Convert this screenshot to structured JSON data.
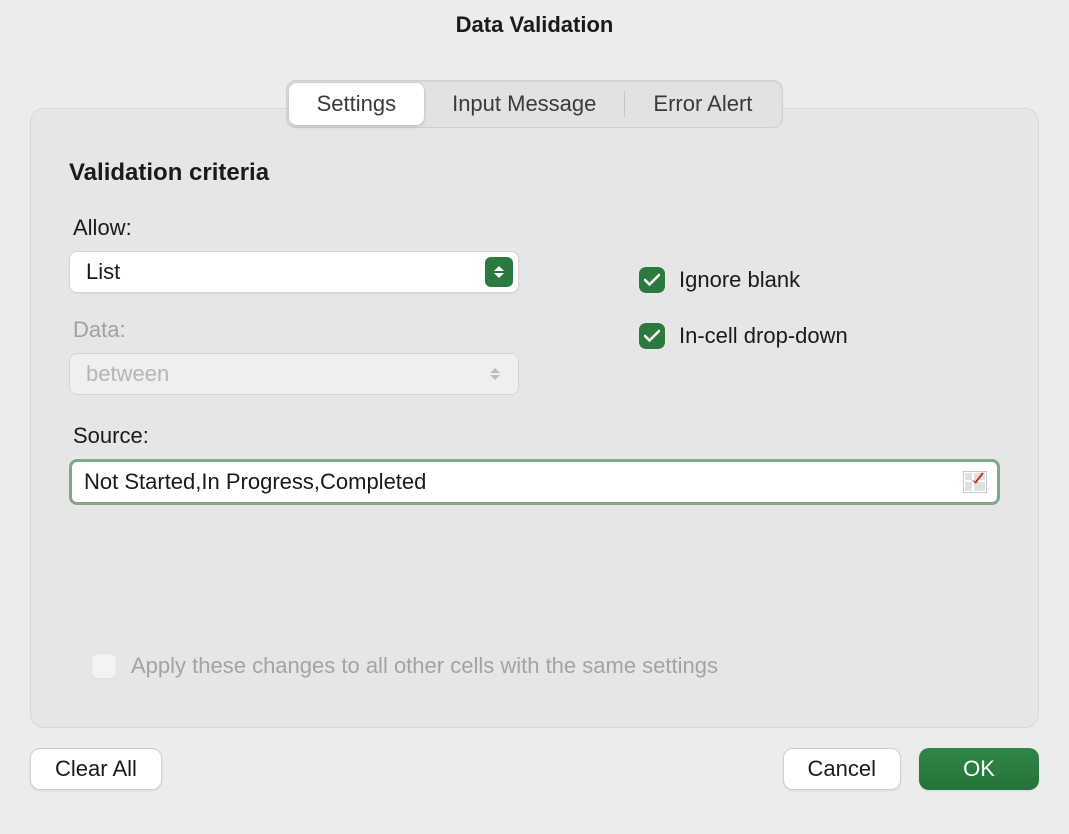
{
  "dialog": {
    "title": "Data Validation"
  },
  "tabs": {
    "settings": "Settings",
    "input_message": "Input Message",
    "error_alert": "Error Alert"
  },
  "section": {
    "title": "Validation criteria"
  },
  "labels": {
    "allow": "Allow:",
    "data": "Data:",
    "source": "Source:"
  },
  "fields": {
    "allow_value": "List",
    "data_value": "between",
    "source_value": "Not Started,In Progress,Completed"
  },
  "checkboxes": {
    "ignore_blank": "Ignore blank",
    "in_cell_dropdown": "In-cell drop-down",
    "apply_all": "Apply these changes to all other cells with the same settings"
  },
  "buttons": {
    "clear_all": "Clear All",
    "cancel": "Cancel",
    "ok": "OK"
  }
}
